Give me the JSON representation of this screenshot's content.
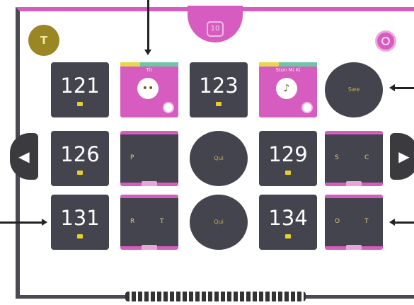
{
  "header": {
    "avatar_letter": "T",
    "top_tab_label": "10"
  },
  "navigation": {
    "prev_icon": "◀",
    "next_icon": "▶"
  },
  "rows": [
    [
      {
        "kind": "number",
        "label": "121"
      },
      {
        "kind": "pink",
        "title": "Tit",
        "pic": "••"
      },
      {
        "kind": "number",
        "label": "123"
      },
      {
        "kind": "pink",
        "title": "Ston Mi Ki",
        "pic": "♪"
      },
      {
        "kind": "circle",
        "label": "Swe"
      }
    ],
    [
      {
        "kind": "number",
        "label": "126"
      },
      {
        "kind": "panel",
        "left": "P",
        "right": ""
      },
      {
        "kind": "circle",
        "label": "Qui"
      },
      {
        "kind": "number",
        "label": "129"
      },
      {
        "kind": "panel",
        "left": "S",
        "right": "C"
      }
    ],
    [
      {
        "kind": "number",
        "label": "131"
      },
      {
        "kind": "panel",
        "left": "R",
        "right": "T"
      },
      {
        "kind": "circle",
        "label": "Qui"
      },
      {
        "kind": "number",
        "label": "134"
      },
      {
        "kind": "panel",
        "left": "O",
        "right": "T"
      }
    ]
  ],
  "colors": {
    "accent": "#d75cc0",
    "card_bg": "#44444e",
    "dot": "#e6cf2e"
  }
}
